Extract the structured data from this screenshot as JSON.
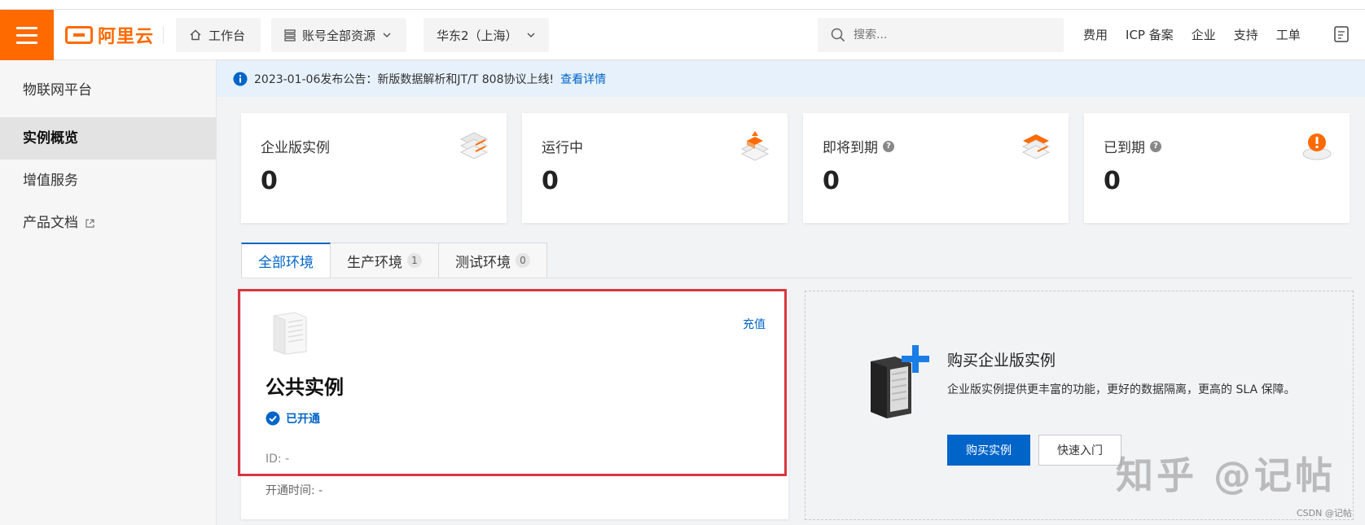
{
  "header": {
    "brand": "阿里云",
    "workbench": "工作台",
    "resources": "账号全部资源",
    "region": "华东2（上海）",
    "search_placeholder": "搜索...",
    "links": [
      "费用",
      "ICP 备案",
      "企业",
      "支持",
      "工单"
    ]
  },
  "sidebar": {
    "title": "物联网平台",
    "items": [
      {
        "label": "实例概览",
        "active": true
      },
      {
        "label": "增值服务",
        "active": false
      },
      {
        "label": "产品文档",
        "active": false
      }
    ]
  },
  "notice": {
    "text": "2023-01-06发布公告：新版数据解析和JT/T 808协议上线!",
    "link": "查看详情"
  },
  "stats": [
    {
      "label": "企业版实例",
      "value": "0",
      "help": false
    },
    {
      "label": "运行中",
      "value": "0",
      "help": false
    },
    {
      "label": "即将到期",
      "value": "0",
      "help": true
    },
    {
      "label": "已到期",
      "value": "0",
      "help": true
    }
  ],
  "tabs": [
    {
      "label": "全部环境",
      "count": null
    },
    {
      "label": "生产环境",
      "count": "1"
    },
    {
      "label": "测试环境",
      "count": "0"
    }
  ],
  "instance": {
    "recharge": "充值",
    "title": "公共实例",
    "status": "已开通",
    "id_line": "ID: -",
    "time_line": "开通时间: -"
  },
  "buy": {
    "title": "购买企业版实例",
    "desc": "企业版实例提供更丰富的功能，更好的数据隔离，更高的 SLA 保障。",
    "buy_label": "购买实例",
    "guide_label": "快速入门"
  },
  "watermark": "知乎 @记帖",
  "csdn": "CSDN @记帖",
  "colors": {
    "accent": "#ff6a00",
    "link": "#0064c8",
    "highlight": "#d9363e"
  }
}
